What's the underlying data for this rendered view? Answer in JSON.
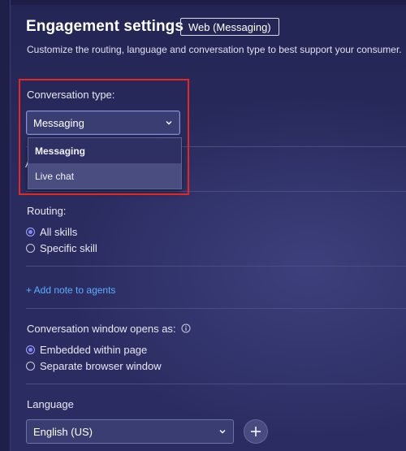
{
  "header": {
    "title": "Engagement settings",
    "channel_badge": "Web (Messaging)",
    "subtitle": "Customize the routing, language and conversation type to best support your consumer."
  },
  "conversation_type": {
    "label": "Conversation type:",
    "selected": "Messaging",
    "options": [
      "Messaging",
      "Live chat"
    ],
    "hovered_option": "Live chat",
    "dropdown_open": true,
    "obscured_label_fragment": "A"
  },
  "routing": {
    "label": "Routing:",
    "options": [
      {
        "label": "All skills",
        "checked": true
      },
      {
        "label": "Specific skill",
        "checked": false
      }
    ]
  },
  "notes": {
    "add_link": "+ Add note to agents"
  },
  "window": {
    "label": "Conversation window opens as:",
    "info_icon": "info-circle-icon",
    "options": [
      {
        "label": "Embedded within page",
        "checked": true
      },
      {
        "label": "Separate browser window",
        "checked": false
      }
    ]
  },
  "language": {
    "label": "Language",
    "selected": "English (US)",
    "add_icon": "plus-icon"
  },
  "colors": {
    "background": "#2a2c60",
    "accent_link": "#5aaeff",
    "highlight_box": "#e8261f",
    "radio_selected": "#7f88ff"
  }
}
